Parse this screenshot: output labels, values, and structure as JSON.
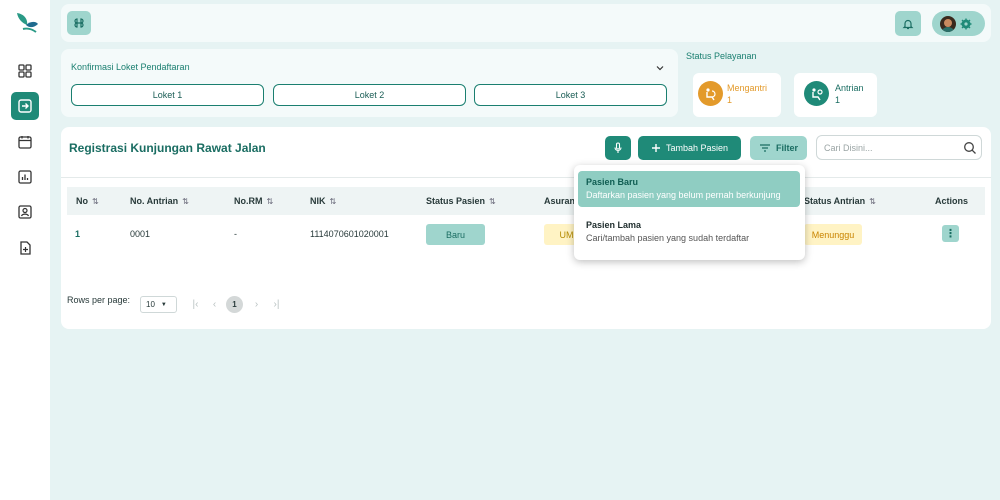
{
  "colors": {
    "primary": "#1f8a78",
    "light": "#9fd5cd",
    "background": "#e6f3f3",
    "warning": "#fff3c4",
    "queue": "#e39a2b"
  },
  "sidebar": {
    "items": [
      {
        "icon": "dashboard-icon",
        "active": false
      },
      {
        "icon": "login-icon",
        "active": true
      },
      {
        "icon": "calendar-icon",
        "active": false
      },
      {
        "icon": "chart-icon",
        "active": false
      },
      {
        "icon": "user-card-icon",
        "active": false
      },
      {
        "icon": "file-add-icon",
        "active": false
      }
    ]
  },
  "counters": {
    "title": "Konfirmasi Loket Pendaftaran",
    "lokets": [
      "Loket 1",
      "Loket 2",
      "Loket 3"
    ]
  },
  "status": {
    "title": "Status Pelayanan",
    "queue_label": "Mengantri",
    "queue_count": "1",
    "active_label": "Antrian",
    "active_count": "1"
  },
  "main": {
    "title": "Registrasi Kunjungan Rawat Jalan",
    "add_label": "Tambah Pasien",
    "filter_label": "Filter",
    "search_placeholder": "Cari Disini..."
  },
  "table": {
    "headers": [
      "No",
      "No. Antrian",
      "No.RM",
      "NIK",
      "Status Pasien",
      "Asuran",
      "Status Antrian",
      "Actions"
    ],
    "row": {
      "no": "1",
      "antrian": "0001",
      "rm": "-",
      "nik": "1114070601020001",
      "status_pasien": "Baru",
      "asuransi": "UM",
      "status_antrian": "Menunggu",
      "action": "⋮"
    }
  },
  "pagination": {
    "rows_per_page_label": "Rows per page:",
    "rows_per_page": "10",
    "current_page": "1"
  },
  "dropdown": {
    "items": [
      {
        "title": "Pasien Baru",
        "desc": "Daftarkan pasien yang belum pernah berkunjung"
      },
      {
        "title": "Pasien Lama",
        "desc": "Cari/tambah pasien yang sudah terdaftar"
      }
    ]
  }
}
